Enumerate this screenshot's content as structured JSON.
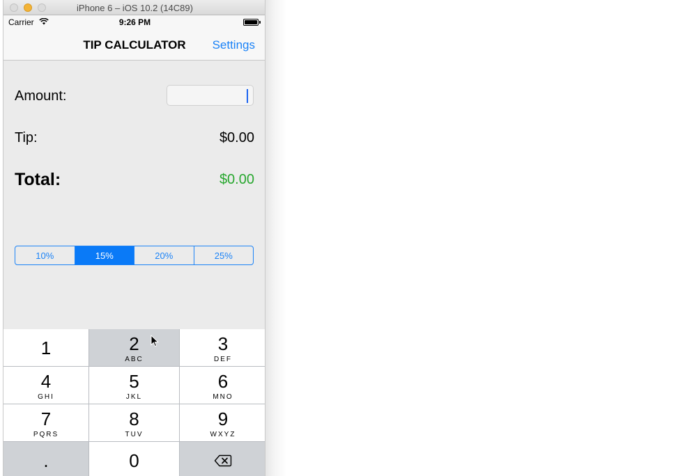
{
  "window": {
    "title": "iPhone 6 – iOS 10.2 (14C89)"
  },
  "status_bar": {
    "carrier": "Carrier",
    "time": "9:26 PM",
    "wifi_icon": "wifi-icon",
    "battery_icon": "battery-icon"
  },
  "nav": {
    "title": "TIP CALCULATOR",
    "settings_label": "Settings"
  },
  "form": {
    "amount_label": "Amount:",
    "amount_value": "",
    "tip_label": "Tip:",
    "tip_value": "$0.00",
    "total_label": "Total:",
    "total_value": "$0.00"
  },
  "tip_options": [
    {
      "label": "10%",
      "selected": false
    },
    {
      "label": "15%",
      "selected": true
    },
    {
      "label": "20%",
      "selected": false
    },
    {
      "label": "25%",
      "selected": false
    }
  ],
  "keypad": {
    "keys": [
      {
        "number": "1",
        "letters": ""
      },
      {
        "number": "2",
        "letters": "ABC"
      },
      {
        "number": "3",
        "letters": "DEF"
      },
      {
        "number": "4",
        "letters": "GHI"
      },
      {
        "number": "5",
        "letters": "JKL"
      },
      {
        "number": "6",
        "letters": "MNO"
      },
      {
        "number": "7",
        "letters": "PQRS"
      },
      {
        "number": "8",
        "letters": "TUV"
      },
      {
        "number": "9",
        "letters": "WXYZ"
      },
      {
        "number": ".",
        "letters": ""
      },
      {
        "number": "0",
        "letters": ""
      }
    ],
    "delete_icon": "backspace-icon",
    "pressed_key": "2"
  },
  "colors": {
    "accent": "#1a82f7",
    "total_green": "#28a72f",
    "pressed_key": "#cfd2d6"
  }
}
